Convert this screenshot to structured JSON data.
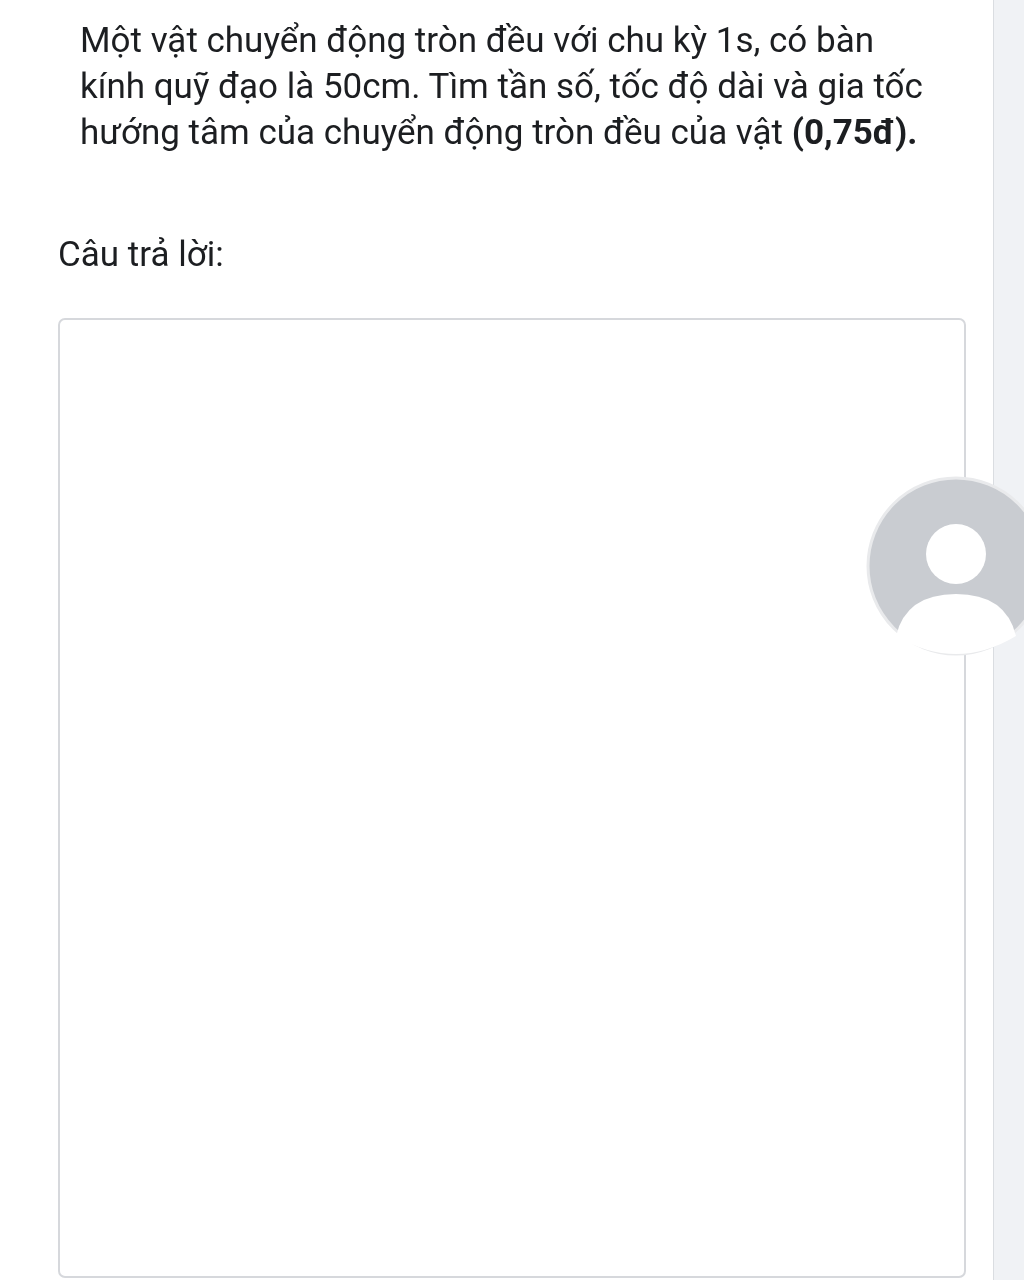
{
  "question": "Một vật chuyển động tròn đều với chu kỳ 1s, có bàn kính quỹ đạo là 50cm. Tìm tần số, tốc độ dài và gia tốc hướng tâm của chuyển động tròn đều của vật **(0,75đ).**",
  "answer_label": "Câu trả lời:"
}
